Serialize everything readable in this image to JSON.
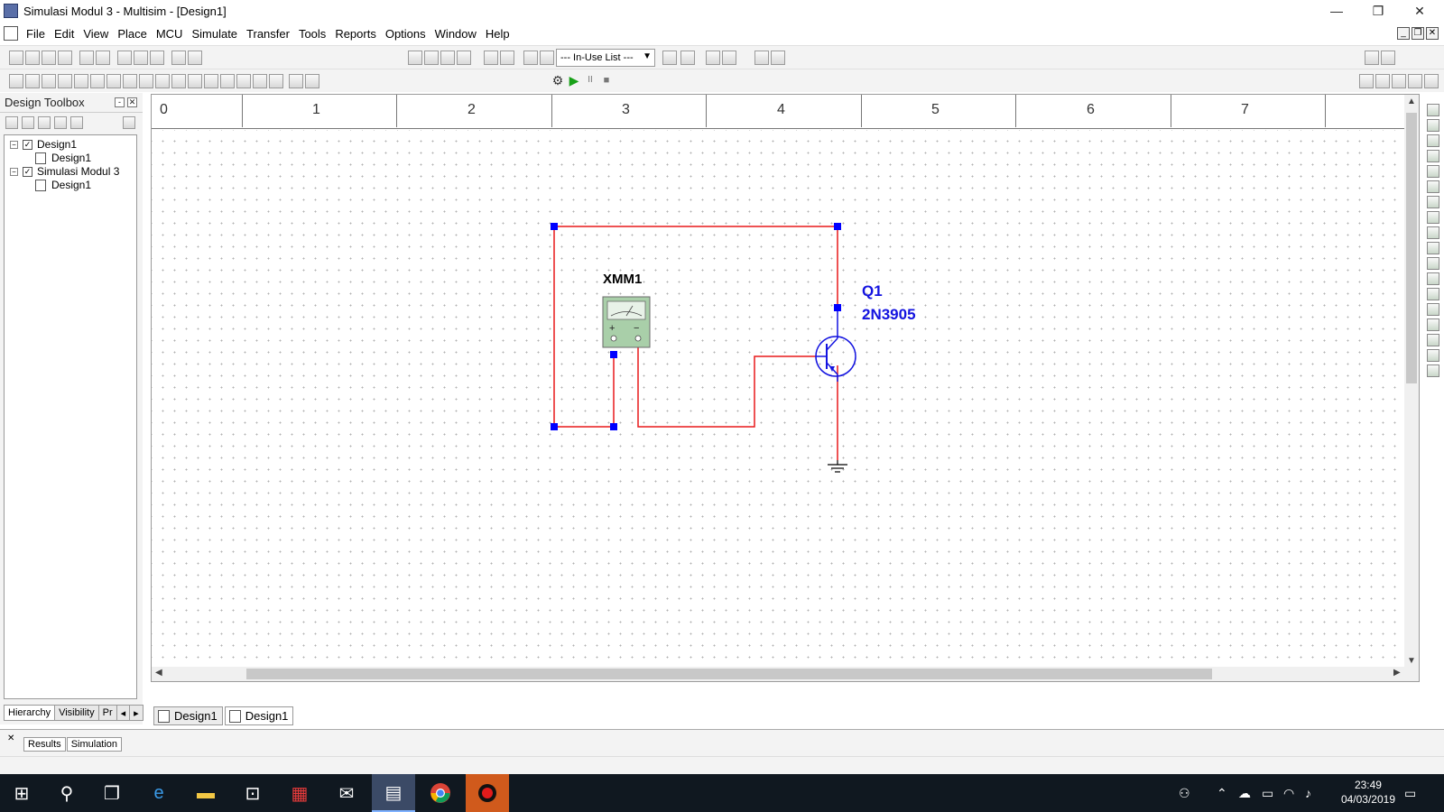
{
  "window": {
    "title": "Simulasi Modul 3 - Multisim - [Design1]",
    "controls": {
      "minimize": "—",
      "restore": "❐",
      "close": "✕"
    }
  },
  "menu": [
    "File",
    "Edit",
    "View",
    "Place",
    "MCU",
    "Simulate",
    "Transfer",
    "Tools",
    "Reports",
    "Options",
    "Window",
    "Help"
  ],
  "toolbar": {
    "in_use_list": "--- In-Use List ---",
    "sim_pause": "II",
    "sim_stop": "■",
    "sim_run": "▶"
  },
  "toolbox": {
    "title": "Design Toolbox",
    "tree": [
      {
        "label": "Design1",
        "level": 0
      },
      {
        "label": "Design1",
        "level": 1
      },
      {
        "label": "Simulasi Modul 3",
        "level": 0
      },
      {
        "label": "Design1",
        "level": 1
      }
    ],
    "tabs": [
      "Hierarchy",
      "Visibility",
      "Pr"
    ]
  },
  "ruler": {
    "labels": [
      "0",
      "1",
      "2",
      "3",
      "4",
      "5",
      "6",
      "7"
    ]
  },
  "schematic": {
    "multimeter": {
      "ref": "XMM1",
      "plus": "+",
      "minus": "−"
    },
    "transistor": {
      "ref": "Q1",
      "model": "2N3905"
    },
    "wire_color": "#e8191a",
    "component_color": "#1313e0",
    "junction_color": "#0000ff"
  },
  "sheet_tabs": [
    "Design1",
    "Design1"
  ],
  "bottom_tabs": [
    "Results",
    "Simulation"
  ],
  "taskbar": {
    "time": "23:49",
    "date": "04/03/2019"
  }
}
